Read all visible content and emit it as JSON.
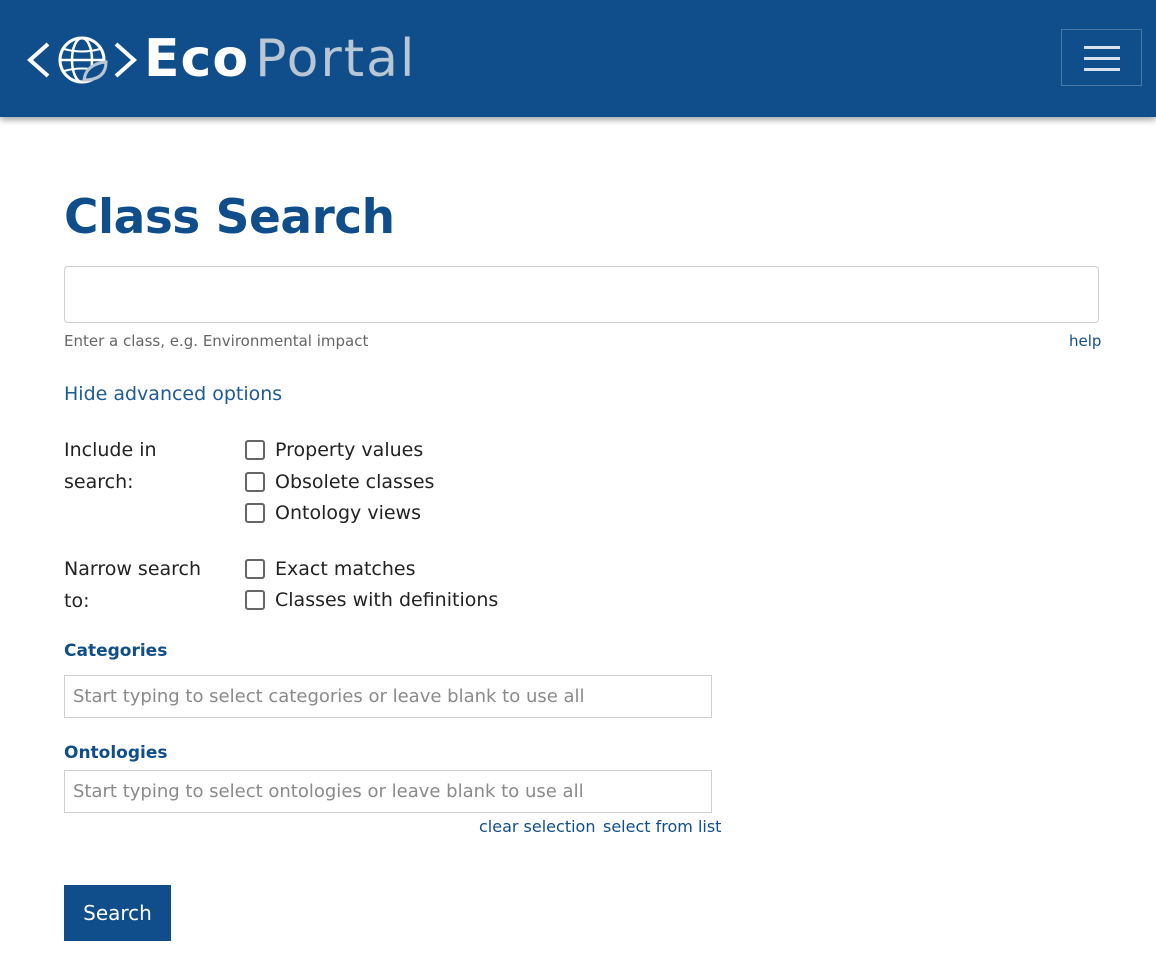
{
  "brand": {
    "name_bold": "Eco",
    "name_light": "Portal",
    "logo_icon": "globe-leaf-icon"
  },
  "nav": {
    "menu_icon": "hamburger-icon"
  },
  "page": {
    "title": "Class Search"
  },
  "search": {
    "value": "",
    "placeholder": "",
    "hint": "Enter a class, e.g. Environmental impact",
    "help_label": "help",
    "advanced_toggle_label": "Hide advanced options"
  },
  "options": {
    "include": {
      "label": "Include in search:",
      "items": [
        {
          "label": "Property values",
          "checked": false
        },
        {
          "label": "Obsolete classes",
          "checked": false
        },
        {
          "label": "Ontology views",
          "checked": false
        }
      ]
    },
    "narrow": {
      "label": "Narrow search to:",
      "items": [
        {
          "label": "Exact matches",
          "checked": false
        },
        {
          "label": "Classes with definitions",
          "checked": false
        }
      ]
    }
  },
  "categories": {
    "label": "Categories",
    "placeholder": "Start typing to select categories or leave blank to use all"
  },
  "ontologies": {
    "label": "Ontologies",
    "placeholder": "Start typing to select ontologies or leave blank to use all",
    "clear_label": "clear selection",
    "select_label": "select from list"
  },
  "submit": {
    "label": "Search"
  },
  "colors": {
    "brand_blue": "#0f4e8b",
    "link_blue": "#1d5a96",
    "logo_light": "#b9c6d4"
  }
}
